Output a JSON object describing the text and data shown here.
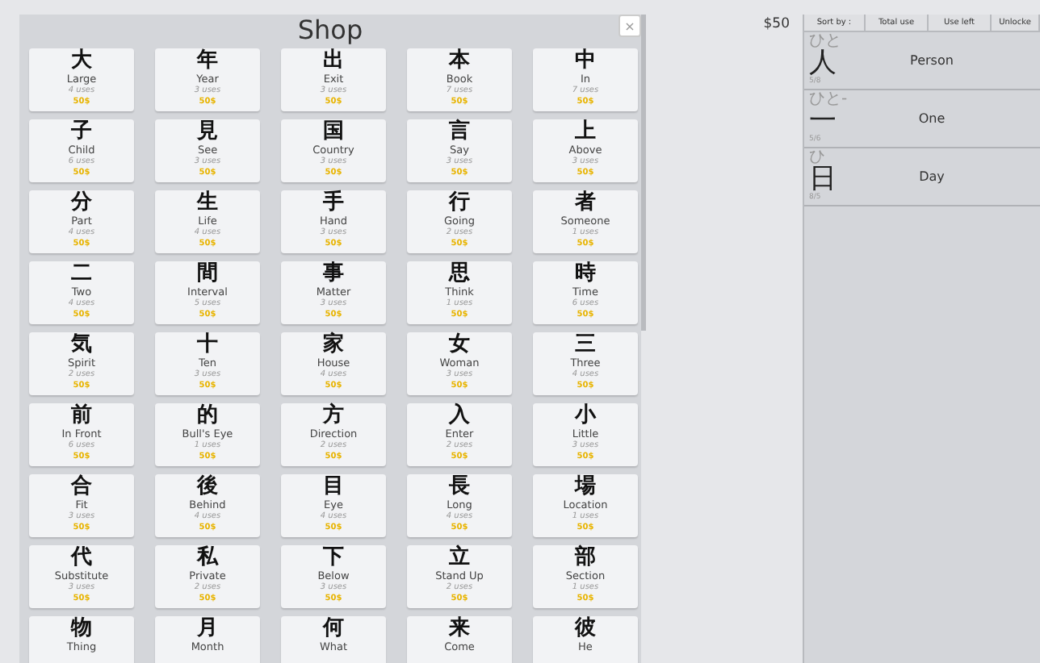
{
  "shop": {
    "title": "Shop",
    "close": "×",
    "cards": [
      {
        "kanji": "大",
        "meaning": "Large",
        "uses": "4 uses",
        "price": "50$"
      },
      {
        "kanji": "年",
        "meaning": "Year",
        "uses": "3 uses",
        "price": "50$"
      },
      {
        "kanji": "出",
        "meaning": "Exit",
        "uses": "3 uses",
        "price": "50$"
      },
      {
        "kanji": "本",
        "meaning": "Book",
        "uses": "7 uses",
        "price": "50$"
      },
      {
        "kanji": "中",
        "meaning": "In",
        "uses": "7 uses",
        "price": "50$"
      },
      {
        "kanji": "子",
        "meaning": "Child",
        "uses": "6 uses",
        "price": "50$"
      },
      {
        "kanji": "見",
        "meaning": "See",
        "uses": "3 uses",
        "price": "50$"
      },
      {
        "kanji": "国",
        "meaning": "Country",
        "uses": "3 uses",
        "price": "50$"
      },
      {
        "kanji": "言",
        "meaning": "Say",
        "uses": "3 uses",
        "price": "50$"
      },
      {
        "kanji": "上",
        "meaning": "Above",
        "uses": "3 uses",
        "price": "50$"
      },
      {
        "kanji": "分",
        "meaning": "Part",
        "uses": "4 uses",
        "price": "50$"
      },
      {
        "kanji": "生",
        "meaning": "Life",
        "uses": "4 uses",
        "price": "50$"
      },
      {
        "kanji": "手",
        "meaning": "Hand",
        "uses": "3 uses",
        "price": "50$"
      },
      {
        "kanji": "行",
        "meaning": "Going",
        "uses": "2 uses",
        "price": "50$"
      },
      {
        "kanji": "者",
        "meaning": "Someone",
        "uses": "1 uses",
        "price": "50$"
      },
      {
        "kanji": "二",
        "meaning": "Two",
        "uses": "4 uses",
        "price": "50$"
      },
      {
        "kanji": "間",
        "meaning": "Interval",
        "uses": "5 uses",
        "price": "50$"
      },
      {
        "kanji": "事",
        "meaning": "Matter",
        "uses": "3 uses",
        "price": "50$"
      },
      {
        "kanji": "思",
        "meaning": "Think",
        "uses": "1 uses",
        "price": "50$"
      },
      {
        "kanji": "時",
        "meaning": "Time",
        "uses": "6 uses",
        "price": "50$"
      },
      {
        "kanji": "気",
        "meaning": "Spirit",
        "uses": "2 uses",
        "price": "50$"
      },
      {
        "kanji": "十",
        "meaning": "Ten",
        "uses": "3 uses",
        "price": "50$"
      },
      {
        "kanji": "家",
        "meaning": "House",
        "uses": "4 uses",
        "price": "50$"
      },
      {
        "kanji": "女",
        "meaning": "Woman",
        "uses": "3 uses",
        "price": "50$"
      },
      {
        "kanji": "三",
        "meaning": "Three",
        "uses": "4 uses",
        "price": "50$"
      },
      {
        "kanji": "前",
        "meaning": "In Front",
        "uses": "6 uses",
        "price": "50$"
      },
      {
        "kanji": "的",
        "meaning": "Bull's Eye",
        "uses": "1 uses",
        "price": "50$"
      },
      {
        "kanji": "方",
        "meaning": "Direction",
        "uses": "2 uses",
        "price": "50$"
      },
      {
        "kanji": "入",
        "meaning": "Enter",
        "uses": "2 uses",
        "price": "50$"
      },
      {
        "kanji": "小",
        "meaning": "Little",
        "uses": "3 uses",
        "price": "50$"
      },
      {
        "kanji": "合",
        "meaning": "Fit",
        "uses": "3 uses",
        "price": "50$"
      },
      {
        "kanji": "後",
        "meaning": "Behind",
        "uses": "4 uses",
        "price": "50$"
      },
      {
        "kanji": "目",
        "meaning": "Eye",
        "uses": "4 uses",
        "price": "50$"
      },
      {
        "kanji": "長",
        "meaning": "Long",
        "uses": "4 uses",
        "price": "50$"
      },
      {
        "kanji": "場",
        "meaning": "Location",
        "uses": "1 uses",
        "price": "50$"
      },
      {
        "kanji": "代",
        "meaning": "Substitute",
        "uses": "3 uses",
        "price": "50$"
      },
      {
        "kanji": "私",
        "meaning": "Private",
        "uses": "2 uses",
        "price": "50$"
      },
      {
        "kanji": "下",
        "meaning": "Below",
        "uses": "3 uses",
        "price": "50$"
      },
      {
        "kanji": "立",
        "meaning": "Stand Up",
        "uses": "2 uses",
        "price": "50$"
      },
      {
        "kanji": "部",
        "meaning": "Section",
        "uses": "1 uses",
        "price": "50$"
      },
      {
        "kanji": "物",
        "meaning": "Thing"
      },
      {
        "kanji": "月",
        "meaning": "Month"
      },
      {
        "kanji": "何",
        "meaning": "What"
      },
      {
        "kanji": "来",
        "meaning": "Come"
      },
      {
        "kanji": "彼",
        "meaning": "He"
      }
    ]
  },
  "money": "$50",
  "sort": {
    "label": "Sort by :",
    "options": [
      "Total use",
      "Use left",
      "Unlocke"
    ]
  },
  "owned": [
    {
      "reading": "ひと",
      "kanji": "人",
      "meaning": "Person",
      "count": "5/8"
    },
    {
      "reading": "ひと-",
      "kanji": "一",
      "meaning": "One",
      "count": "5/6"
    },
    {
      "reading": "ひ",
      "kanji": "日",
      "meaning": "Day",
      "count": "8/5"
    }
  ]
}
